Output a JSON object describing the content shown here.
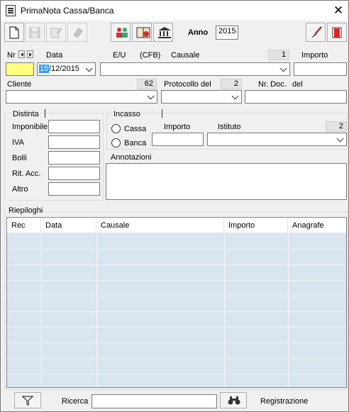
{
  "window": {
    "title": "PrimaNota Cassa/Banca"
  },
  "toolbar": {
    "anno_label": "Anno",
    "anno_value": "2015"
  },
  "header_row": {
    "nr_label": "Nr",
    "data_label": "Data",
    "eu_label": "E/U",
    "cfb_label": "(CFB)",
    "causale_label": "Causale",
    "causale_count": "1",
    "importo_label": "Importo",
    "date_day": "15",
    "date_rest": "/12/2015"
  },
  "cliente_row": {
    "cliente_label": "Cliente",
    "cliente_count": "62",
    "protocollo_label": "Protocollo del",
    "protocollo_count": "2",
    "nrdoc_label": "Nr. Doc.",
    "del_label": "del"
  },
  "distinta": {
    "label": "Distinta",
    "fields": [
      {
        "label": "Imponibile"
      },
      {
        "label": "IVA"
      },
      {
        "label": "Bolli"
      },
      {
        "label": "Rit. Acc."
      },
      {
        "label": "Altro"
      }
    ]
  },
  "incasso": {
    "label": "Incasso",
    "cassa_label": "Cassa",
    "banca_label": "Banca",
    "importo_label": "Importo",
    "istituto_label": "Istituto",
    "istituto_count": "2"
  },
  "annotazioni_label": "Annotazioni",
  "riepiloghi": {
    "label": "Riepiloghi",
    "columns": [
      "Rec",
      "Data",
      "Causale",
      "Importo",
      "Anagrafe"
    ]
  },
  "footer": {
    "ricerca_label": "Ricerca",
    "registrazione_label": "Registrazione"
  }
}
